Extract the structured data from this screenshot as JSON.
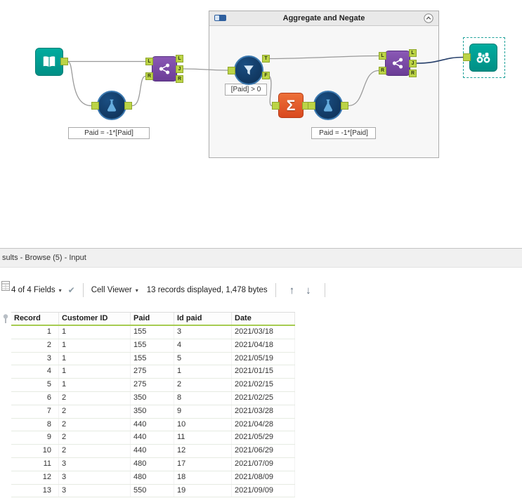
{
  "canvas": {
    "container_title": "Aggregate and Negate",
    "annotations": {
      "formula1": "Paid = -1*[Paid]",
      "filter": "[Paid] > 0",
      "formula2": "Paid = -1*[Paid]"
    },
    "anchor_labels": {
      "L": "L",
      "J": "J",
      "R": "R",
      "T": "T",
      "F": "F"
    },
    "summarize_glyph": "Σ"
  },
  "results": {
    "titlebar": "sults - Browse (5) - Input",
    "toolbar": {
      "fields_dropdown": "4 of 4 Fields",
      "check_icon": "✔",
      "cell_viewer_dropdown": "Cell Viewer",
      "records_info": "13 records displayed, 1,478 bytes",
      "up_arrow": "↑",
      "down_arrow": "↓",
      "caret": "▾"
    },
    "table": {
      "columns": [
        "Record",
        "Customer ID",
        "Paid",
        "Id paid",
        "Date"
      ],
      "rows": [
        [
          "1",
          "1",
          "155",
          "3",
          "2021/03/18"
        ],
        [
          "2",
          "1",
          "155",
          "4",
          "2021/04/18"
        ],
        [
          "3",
          "1",
          "155",
          "5",
          "2021/05/19"
        ],
        [
          "4",
          "1",
          "275",
          "1",
          "2021/01/15"
        ],
        [
          "5",
          "1",
          "275",
          "2",
          "2021/02/15"
        ],
        [
          "6",
          "2",
          "350",
          "8",
          "2021/02/25"
        ],
        [
          "7",
          "2",
          "350",
          "9",
          "2021/03/28"
        ],
        [
          "8",
          "2",
          "440",
          "10",
          "2021/04/28"
        ],
        [
          "9",
          "2",
          "440",
          "11",
          "2021/05/29"
        ],
        [
          "10",
          "2",
          "440",
          "12",
          "2021/06/29"
        ],
        [
          "11",
          "3",
          "480",
          "17",
          "2021/07/09"
        ],
        [
          "12",
          "3",
          "480",
          "18",
          "2021/08/09"
        ],
        [
          "13",
          "3",
          "550",
          "19",
          "2021/09/09"
        ]
      ]
    }
  }
}
